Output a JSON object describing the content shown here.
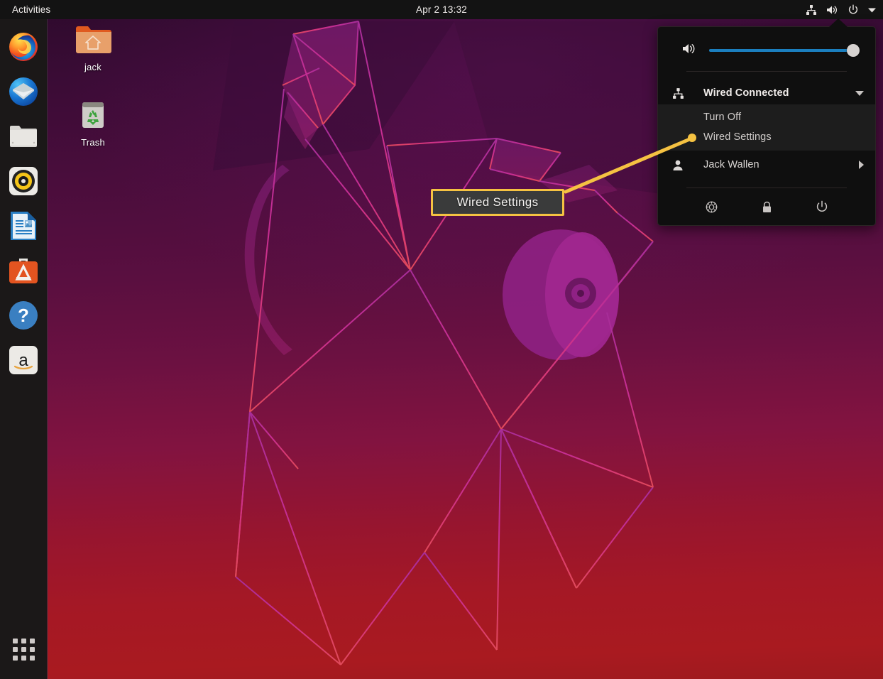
{
  "topbar": {
    "activities_label": "Activities",
    "clock": "Apr 2  13:32",
    "tray_icons": [
      "network-wired-icon",
      "volume-icon",
      "power-icon",
      "chevron-down-icon"
    ]
  },
  "dock": {
    "items": [
      {
        "name": "firefox",
        "label": "Firefox"
      },
      {
        "name": "thunderbird",
        "label": "Thunderbird Mail"
      },
      {
        "name": "files",
        "label": "Files"
      },
      {
        "name": "rhythmbox",
        "label": "Rhythmbox"
      },
      {
        "name": "libreoffice-writer",
        "label": "LibreOffice Writer"
      },
      {
        "name": "ubuntu-software",
        "label": "Ubuntu Software"
      },
      {
        "name": "help",
        "label": "Help"
      },
      {
        "name": "amazon",
        "label": "Amazon"
      }
    ],
    "show_apps_label": "Show Applications"
  },
  "desktop": {
    "icons": [
      {
        "name": "home-folder",
        "label": "jack"
      },
      {
        "name": "trash",
        "label": "Trash"
      }
    ]
  },
  "sysmenu": {
    "volume": {
      "icon": "volume-icon",
      "value": 100
    },
    "network": {
      "icon": "network-wired-icon",
      "label": "Wired Connected",
      "expand_icon": "chevron-down-icon",
      "submenu": [
        {
          "name": "turn-off",
          "label": "Turn Off"
        },
        {
          "name": "wired-settings",
          "label": "Wired Settings"
        }
      ]
    },
    "user": {
      "icon": "user-icon",
      "label": "Jack Wallen",
      "expand_icon": "chevron-right-icon"
    },
    "actions": [
      {
        "name": "settings",
        "icon": "gear-icon",
        "label": "Settings"
      },
      {
        "name": "lock",
        "icon": "lock-icon",
        "label": "Lock"
      },
      {
        "name": "power",
        "icon": "power-icon",
        "label": "Power Off / Log Out"
      }
    ]
  },
  "callout": {
    "label": "Wired Settings",
    "border_color": "#f5c242",
    "fill_color": "#3a3b3b"
  },
  "colors": {
    "panel_bg": "#0f0f0f",
    "submenu_bg": "#1d1d1d",
    "topbar_bg": "#131313",
    "dock_bg": "#1b1818",
    "slider_fill": "#1b7fbf",
    "highlight": "#f5c242"
  }
}
